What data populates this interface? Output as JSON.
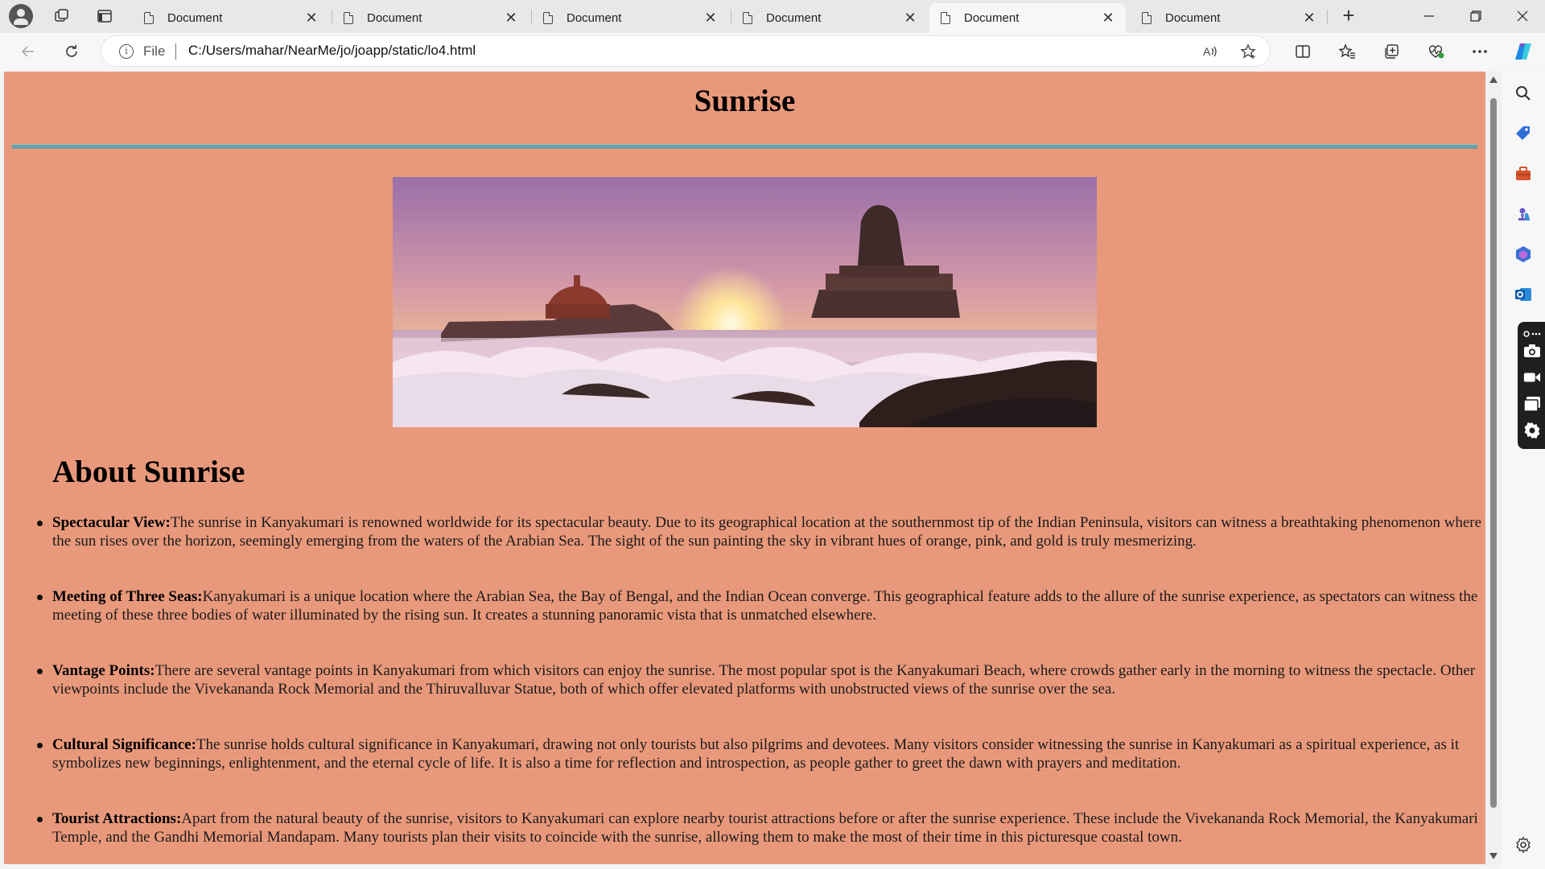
{
  "browser": {
    "tabs": [
      {
        "title": "Document",
        "active": false
      },
      {
        "title": "Document",
        "active": false
      },
      {
        "title": "Document",
        "active": false
      },
      {
        "title": "Document",
        "active": false
      },
      {
        "title": "Document",
        "active": true
      },
      {
        "title": "Document",
        "active": false
      }
    ],
    "tab_close_glyph": "✕",
    "new_tab_glyph": "+",
    "address": {
      "scheme_label": "File",
      "url": "C:/Users/mahar/NearMe/jo/joapp/static/lo4.html"
    },
    "icons": {
      "back": "back-arrow-icon",
      "reload": "reload-icon",
      "read_aloud": "read-aloud-icon",
      "favorite": "star-icon",
      "split": "split-screen-icon",
      "favorites": "favorites-icon",
      "collections": "collections-icon",
      "health": "browser-essentials-icon",
      "more": "more-icon",
      "copilot": "copilot-icon"
    }
  },
  "page": {
    "background": "#e9997b",
    "rule_color": "#6b9fa6",
    "title": "Sunrise",
    "section_title": "About Sunrise",
    "hero_alt": "Kanyakumari sunrise with Vivekananda Rock Memorial and Thiruvalluvar Statue",
    "points": [
      {
        "label": "Spectacular View:",
        "text": "The sunrise in Kanyakumari is renowned worldwide for its spectacular beauty. Due to its geographical location at the southernmost tip of the Indian Peninsula, visitors can witness a breathtaking phenomenon where the sun rises over the horizon, seemingly emerging from the waters of the Arabian Sea. The sight of the sun painting the sky in vibrant hues of orange, pink, and gold is truly mesmerizing."
      },
      {
        "label": "Meeting of Three Seas:",
        "text": "Kanyakumari is a unique location where the Arabian Sea, the Bay of Bengal, and the Indian Ocean converge. This geographical feature adds to the allure of the sunrise experience, as spectators can witness the meeting of these three bodies of water illuminated by the rising sun. It creates a stunning panoramic vista that is unmatched elsewhere."
      },
      {
        "label": "Vantage Points:",
        "text": "There are several vantage points in Kanyakumari from which visitors can enjoy the sunrise. The most popular spot is the Kanyakumari Beach, where crowds gather early in the morning to witness the spectacle. Other viewpoints include the Vivekananda Rock Memorial and the Thiruvalluvar Statue, both of which offer elevated platforms with unobstructed views of the sunrise over the sea."
      },
      {
        "label": "Cultural Significance:",
        "text": "The sunrise holds cultural significance in Kanyakumari, drawing not only tourists but also pilgrims and devotees. Many visitors consider witnessing the sunrise in Kanyakumari as a spiritual experience, as it symbolizes new beginnings, enlightenment, and the eternal cycle of life. It is also a time for reflection and introspection, as people gather to greet the dawn with prayers and meditation."
      },
      {
        "label": "Tourist Attractions:",
        "text": "Apart from the natural beauty of the sunrise, visitors to Kanyakumari can explore nearby tourist attractions before or after the sunrise experience. These include the Vivekananda Rock Memorial, the Kanyakumari Temple, and the Gandhi Memorial Mandapam. Many tourists plan their visits to coincide with the sunrise, allowing them to make the most of their time in this picturesque coastal town."
      }
    ]
  },
  "sidebar": {
    "icons": [
      "search-icon",
      "shopping-tag-icon",
      "tools-icon",
      "games-icon",
      "microsoft-365-icon",
      "outlook-icon",
      "settings-icon"
    ],
    "capture_icons": [
      "camera-icon",
      "video-icon",
      "window-icon",
      "gear-icon"
    ]
  }
}
